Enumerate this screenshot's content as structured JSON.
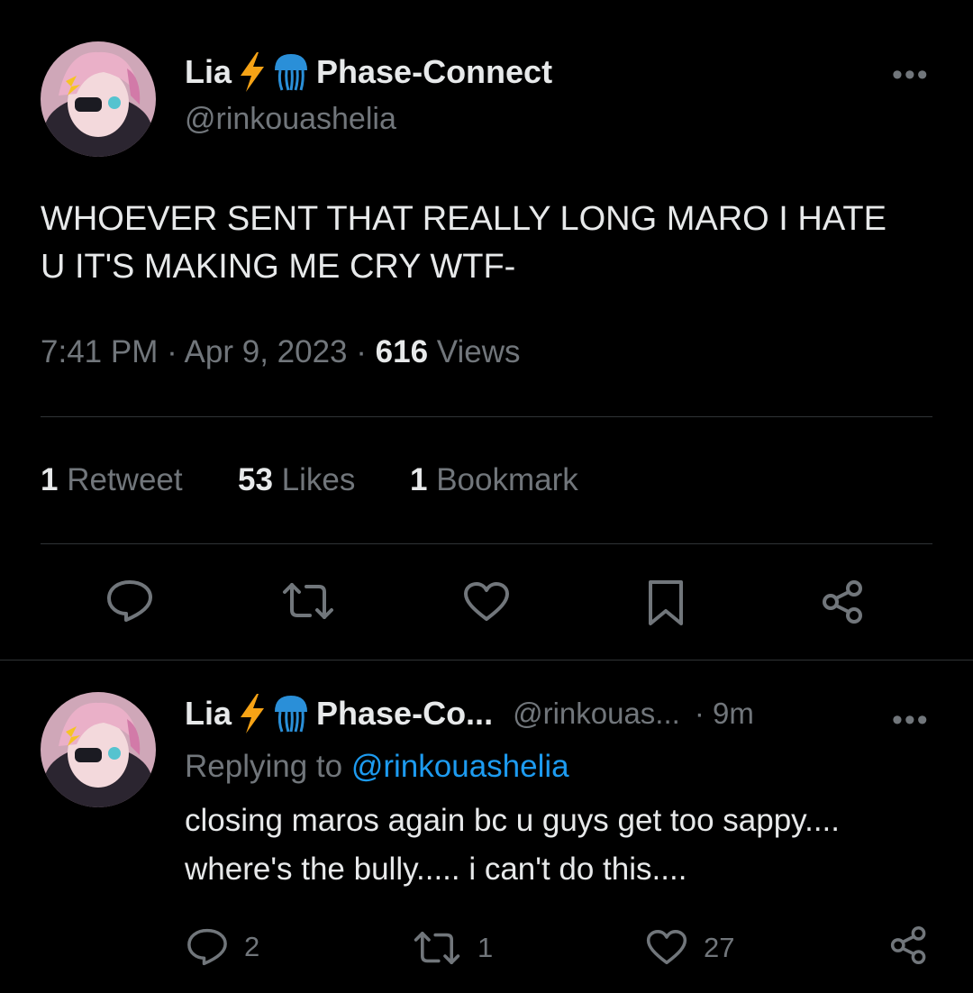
{
  "tweet": {
    "author_name": "Lia",
    "org_name": "Phase-Connect",
    "handle": "@rinkouashelia",
    "text": "WHOEVER SENT THAT REALLY LONG MARO I HATE U IT'S MAKING ME CRY WTF-",
    "time": "7:41 PM",
    "sep": "·",
    "date": "Apr 9, 2023",
    "views_count": "616",
    "views_label": "Views",
    "retweets_count": "1",
    "retweets_label": "Retweet",
    "likes_count": "53",
    "likes_label": "Likes",
    "bookmarks_count": "1",
    "bookmarks_label": "Bookmark",
    "more": "•••"
  },
  "reply": {
    "author_name": "Lia",
    "org_name": "Phase-Co...",
    "handle": "@rinkouas...",
    "age": "· 9m",
    "replying_prefix": "Replying to",
    "replying_handle": "@rinkouashelia",
    "text_line1": "closing maros again bc u guys get too sappy....",
    "text_line2": "where's the bully..... i can't do this....",
    "replies_count": "2",
    "retweets_count": "1",
    "likes_count": "27",
    "more": "•••"
  },
  "icons": {
    "badge_bolt": "lightning-bolt-icon",
    "badge_org": "jellyfish-icon",
    "reply": "speech-bubble-icon",
    "retweet": "retweet-arrows-icon",
    "like": "heart-icon",
    "bookmark": "bookmark-icon",
    "share": "share-icon"
  },
  "colors": {
    "background": "#000000",
    "text_primary": "#e7e9ea",
    "text_secondary": "#71767b",
    "link": "#1d9bf0",
    "divider": "#2f3336",
    "bolt": "#f6a316",
    "jellyfish": "#2a8fd8"
  }
}
